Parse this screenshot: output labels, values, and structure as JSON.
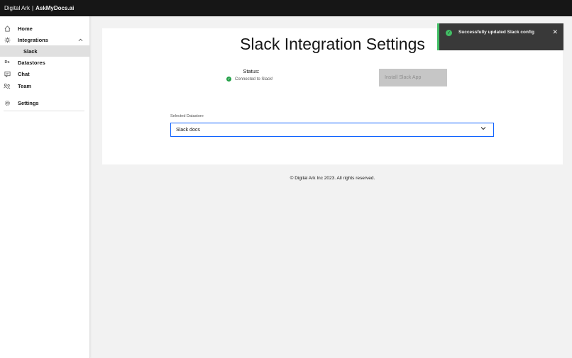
{
  "header": {
    "brand": "Digital Ark",
    "separator": "|",
    "product": "AskMyDocs.ai"
  },
  "sidebar": {
    "items": [
      {
        "label": "Home",
        "icon": "home-icon"
      },
      {
        "label": "Integrations",
        "icon": "integrations-icon",
        "expanded": true
      },
      {
        "label": "Slack",
        "sub": true,
        "selected": true
      },
      {
        "label": "Datastores",
        "icon": "datastore-icon",
        "icon_text": "Ds"
      },
      {
        "label": "Chat",
        "icon": "chat-icon"
      },
      {
        "label": "Team",
        "icon": "team-icon"
      },
      {
        "label": "Settings",
        "icon": "gear-icon"
      }
    ]
  },
  "main": {
    "title": "Slack Integration Settings",
    "status_label": "Status:",
    "status_text": "Connected to Slack!",
    "install_button": "Install Slack App",
    "datastore_label": "Selected Datastore",
    "datastore_value": "Slack docs"
  },
  "footer": {
    "text": "© Digital Ark Inc 2023. All rights reserved."
  },
  "toast": {
    "message": "Successfully updated Slack config",
    "close": "✕"
  },
  "colors": {
    "topbar": "#161616",
    "accent": "#0f62fe",
    "success": "#24a148",
    "toast_bg": "#393939"
  }
}
